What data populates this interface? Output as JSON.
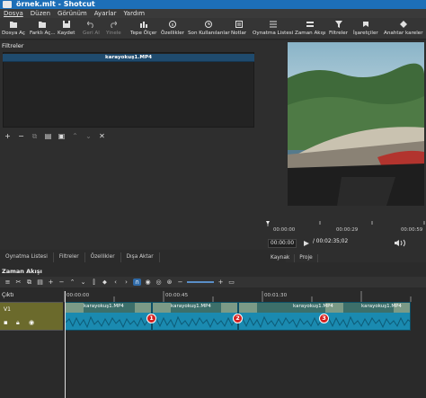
{
  "window": {
    "title": "örnek.mlt - Shotcut"
  },
  "menu": [
    "Dosya",
    "Düzen",
    "Görünüm",
    "Ayarlar",
    "Yardım"
  ],
  "toolbar": [
    {
      "label": "Dosya Aç",
      "icon": "folder-open-icon"
    },
    {
      "label": "Farklı Aç...",
      "icon": "folder-other-icon"
    },
    {
      "label": "Kaydet",
      "icon": "save-icon"
    },
    {
      "label": "Geri Al",
      "icon": "undo-icon"
    },
    {
      "label": "Yinele",
      "icon": "redo-icon"
    },
    {
      "label": "Tepe Ölçer",
      "icon": "peak-meter-icon"
    },
    {
      "label": "Özellikler",
      "icon": "properties-icon"
    },
    {
      "label": "Son Kullanılanlar",
      "icon": "recent-icon"
    },
    {
      "label": "Notlar",
      "icon": "notes-icon"
    },
    {
      "label": "Oynatma Listesi",
      "icon": "playlist-icon"
    },
    {
      "label": "Zaman Akışı",
      "icon": "timeline-icon"
    },
    {
      "label": "Filtreler",
      "icon": "filter-icon"
    },
    {
      "label": "İşaretçiler",
      "icon": "markers-icon"
    },
    {
      "label": "Anahtar kareler",
      "icon": "keyframes-icon"
    }
  ],
  "filters": {
    "title": "Filtreler",
    "clip_name": "karayokuş1.MP4"
  },
  "left_tabs": [
    "Oynatma Listesi",
    "Filtreler",
    "Özellikler",
    "Dışa Aktar"
  ],
  "player": {
    "ruler": [
      "00:00:00",
      "00:00:29",
      "00:00:59"
    ],
    "position": "00:00:00",
    "duration": "/ 00:02:35;02",
    "tabs": [
      "Kaynak",
      "Proje"
    ]
  },
  "timeline": {
    "title": "Zaman Akışı",
    "master": "Çıktı",
    "track": "V1",
    "ruler": [
      "00:00:00",
      "00:00:45",
      "00:01:30"
    ],
    "clips": [
      {
        "label": "karayokuş1.MP4",
        "marker": "1"
      },
      {
        "label": "karayokuş1.MP4",
        "marker": "2"
      },
      {
        "label": "karayokuş1.MP4",
        "marker": "3"
      }
    ]
  },
  "colors": {
    "titlebar": "#1d6fb8",
    "clip": "#1a8ab0",
    "marker": "#d42020",
    "track_header": "#6b6a2c"
  }
}
